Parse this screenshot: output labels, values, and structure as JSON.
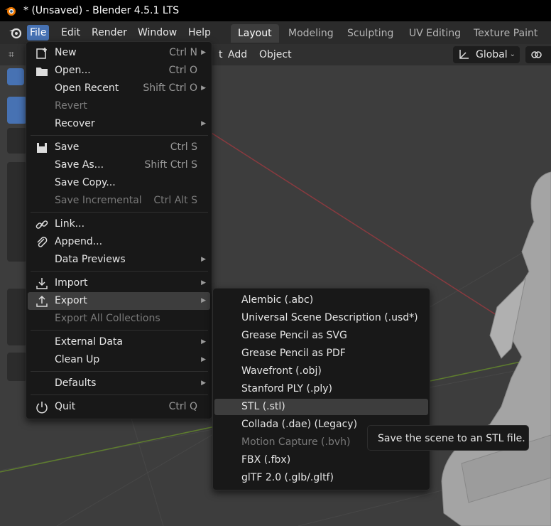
{
  "window": {
    "title": "* (Unsaved) - Blender 4.5.1 LTS"
  },
  "menubar": {
    "items": [
      "File",
      "Edit",
      "Render",
      "Window",
      "Help"
    ]
  },
  "workspaces": [
    "Layout",
    "Modeling",
    "Sculpting",
    "UV Editing",
    "Texture Paint"
  ],
  "header": {
    "add_label": "Add",
    "object_label": "Object",
    "partial_label": "t",
    "transform_orientation": "Global"
  },
  "file_menu": {
    "items": [
      {
        "label": "New",
        "shortcut": "Ctrl N"
      },
      {
        "label": "Open...",
        "shortcut": "Ctrl O"
      },
      {
        "label": "Open Recent",
        "shortcut": "Shift Ctrl O"
      },
      {
        "label": "Revert",
        "shortcut": ""
      },
      {
        "label": "Recover",
        "shortcut": ""
      },
      {
        "label": "Save",
        "shortcut": "Ctrl S"
      },
      {
        "label": "Save As...",
        "shortcut": "Shift Ctrl S"
      },
      {
        "label": "Save Copy...",
        "shortcut": ""
      },
      {
        "label": "Save Incremental",
        "shortcut": "Ctrl Alt S"
      },
      {
        "label": "Link...",
        "shortcut": ""
      },
      {
        "label": "Append...",
        "shortcut": ""
      },
      {
        "label": "Data Previews",
        "shortcut": ""
      },
      {
        "label": "Import",
        "shortcut": ""
      },
      {
        "label": "Export",
        "shortcut": ""
      },
      {
        "label": "Export All Collections",
        "shortcut": ""
      },
      {
        "label": "External Data",
        "shortcut": ""
      },
      {
        "label": "Clean Up",
        "shortcut": ""
      },
      {
        "label": "Defaults",
        "shortcut": ""
      },
      {
        "label": "Quit",
        "shortcut": "Ctrl Q"
      }
    ]
  },
  "export_menu": {
    "items": [
      "Alembic (.abc)",
      "Universal Scene Description (.usd*)",
      "Grease Pencil as SVG",
      "Grease Pencil as PDF",
      "Wavefront (.obj)",
      "Stanford PLY (.ply)",
      "STL (.stl)",
      "Collada (.dae) (Legacy)",
      "Motion Capture (.bvh)",
      "FBX (.fbx)",
      "glTF 2.0 (.glb/.gltf)"
    ]
  },
  "tooltip": {
    "text": "Save the scene to an STL file."
  },
  "colors": {
    "accent": "#4772b3",
    "menu_bg": "#181818",
    "highlight": "#3d3d3d",
    "viewport": "#3d3d3d"
  }
}
